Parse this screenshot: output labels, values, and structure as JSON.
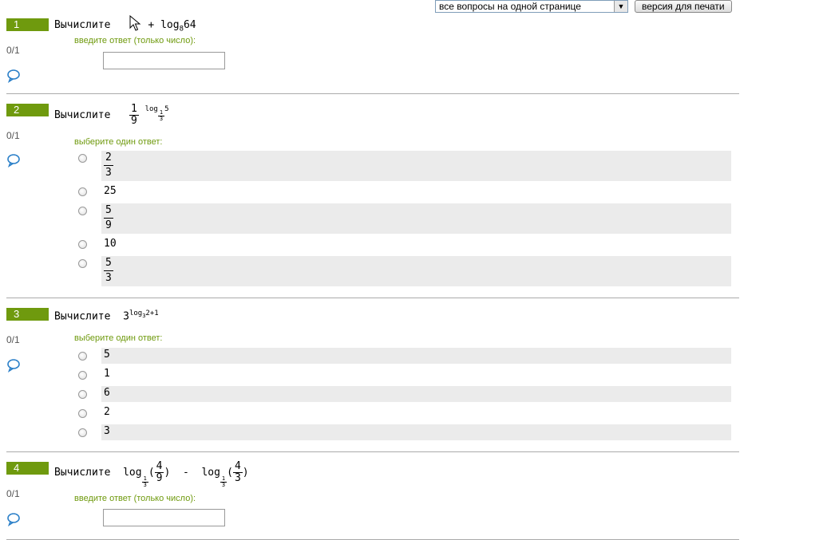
{
  "toolbar": {
    "select_value": "все вопросы на одной странице",
    "print_label": "версия для печати"
  },
  "common": {
    "verb": "Вычислите",
    "score": "0/1",
    "hint_input": "введите ответ (только число):",
    "hint_choice": "выберите один ответ:"
  },
  "q1": {
    "num": "1",
    "expr_plus": "+",
    "log": "log",
    "base": "8",
    "arg": "64"
  },
  "q2": {
    "num": "2",
    "frac_num": "1",
    "frac_den": "9",
    "exp_log": "log",
    "exp_base_num": "1",
    "exp_base_den": "3",
    "exp_arg": "5",
    "options": [
      {
        "type": "frac",
        "num": "2",
        "den": "3"
      },
      {
        "type": "text",
        "text": "25"
      },
      {
        "type": "frac",
        "num": "5",
        "den": "9"
      },
      {
        "type": "text",
        "text": "10"
      },
      {
        "type": "frac",
        "num": "5",
        "den": "3"
      }
    ]
  },
  "q3": {
    "num": "3",
    "base": "3",
    "exp_log": "log",
    "exp_base": "3",
    "exp_rest": "2+1",
    "options": [
      "5",
      "1",
      "6",
      "2",
      "3"
    ]
  },
  "q4": {
    "num": "4",
    "log": "log",
    "base_num": "1",
    "base_den": "3",
    "a_num": "4",
    "a_den": "9",
    "minus": "-",
    "b_num": "4",
    "b_den": "3"
  }
}
